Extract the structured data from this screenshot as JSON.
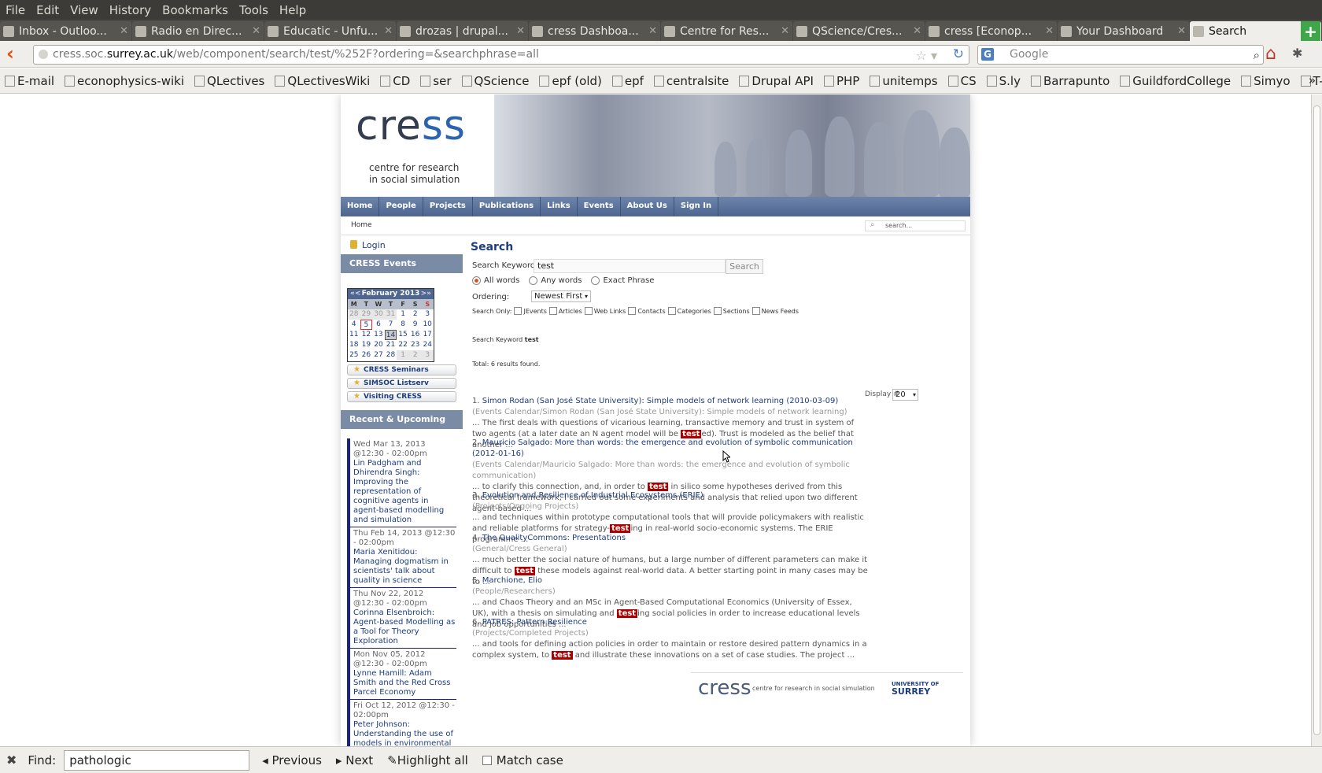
{
  "menubar": [
    "File",
    "Edit",
    "View",
    "History",
    "Bookmarks",
    "Tools",
    "Help"
  ],
  "tabs": [
    {
      "label": "Inbox - Outloo...",
      "icon": "outlook-icon"
    },
    {
      "label": "Radio en Direc...",
      "icon": "radio-icon"
    },
    {
      "label": "Educatic - Unfu...",
      "icon": "unfuddle-icon"
    },
    {
      "label": "drozas | drupal...",
      "icon": "drupal-icon"
    },
    {
      "label": "cress Dashboa...",
      "icon": "page-icon"
    },
    {
      "label": "Centre for Res...",
      "icon": "drupal-icon"
    },
    {
      "label": "QScience/Cres...",
      "icon": "github-icon"
    },
    {
      "label": "cress [Econop...",
      "icon": "epf-icon"
    },
    {
      "label": "Your Dashboard",
      "icon": "page-icon"
    },
    {
      "label": "Search",
      "icon": "page-icon"
    }
  ],
  "url": {
    "pre": "cress.soc.",
    "dom": "surrey.ac.uk",
    "post": "/web/component/search/test/%252F?ordering=&searchphrase=all"
  },
  "search_engine": {
    "placeholder": "Google",
    "icon": "G"
  },
  "bookmarks": [
    {
      "label": "E-mail",
      "icon": "page-icon"
    },
    {
      "label": "econophysics-wiki",
      "icon": "epf-icon"
    },
    {
      "label": "QLectives",
      "icon": "page-icon"
    },
    {
      "label": "QLectivesWiki",
      "icon": "page-icon"
    },
    {
      "label": "CD",
      "icon": "cd-icon"
    },
    {
      "label": "ser",
      "icon": "page-icon"
    },
    {
      "label": "QScience",
      "icon": "github-icon"
    },
    {
      "label": "epf (old)",
      "icon": "epf-icon"
    },
    {
      "label": "epf",
      "icon": "epf-icon"
    },
    {
      "label": "centralsite",
      "icon": "drupal-icon"
    },
    {
      "label": "Drupal API",
      "icon": "drupal-icon"
    },
    {
      "label": "PHP",
      "icon": "php-icon"
    },
    {
      "label": "unitemps",
      "icon": "page-icon"
    },
    {
      "label": "CS",
      "icon": "cs-icon"
    },
    {
      "label": "S.ly",
      "icon": "sly-icon"
    },
    {
      "label": "Barrapunto",
      "icon": "barrapunto-icon"
    },
    {
      "label": "GuildfordCollege",
      "icon": "college-icon"
    },
    {
      "label": "Simyo",
      "icon": "simyo-icon"
    },
    {
      "label": "T-Mob",
      "icon": "tmobile-icon"
    }
  ],
  "site": {
    "logo_a": "cre",
    "logo_b": "ss",
    "tagline1": "centre for research",
    "tagline2": "in social simulation",
    "nav": [
      "Home",
      "People",
      "Projects",
      "Publications",
      "Links",
      "Events",
      "About Us",
      "Sign In"
    ],
    "breadcrumb": "Home",
    "search_placeholder": "search..."
  },
  "sidebar": {
    "login": "Login",
    "calendar_title": "CRESS Events Calendar",
    "calendar": {
      "prev": "«<",
      "month": "February 2013",
      "next": ">»",
      "dow": [
        "M",
        "T",
        "W",
        "T",
        "F",
        "S",
        "S"
      ],
      "weeks": [
        [
          "28",
          "29",
          "30",
          "31",
          "1",
          "2",
          "3"
        ],
        [
          "4",
          "5",
          "6",
          "7",
          "8",
          "9",
          "10"
        ],
        [
          "11",
          "12",
          "13",
          "14",
          "15",
          "16",
          "17"
        ],
        [
          "18",
          "19",
          "20",
          "21",
          "22",
          "23",
          "24"
        ],
        [
          "25",
          "26",
          "27",
          "28",
          "1",
          "2",
          "3"
        ]
      ]
    },
    "links": [
      "CRESS Seminars",
      "SIMSOC Listserv",
      "Visiting CRESS"
    ],
    "events_title": "Recent & Upcoming Events",
    "events": [
      {
        "date": "Wed Mar 13, 2013 @12:30 - 02:00pm",
        "title": "Lin Padgham and Dhirendra Singh: Improving the representation of cognitive agents in agent-based modelling and simulation"
      },
      {
        "date": "Thu Feb 14, 2013 @12:30 - 02:00pm",
        "title": "Maria Xenitidou: Managing dogmatism in scientists' talk about quality in science"
      },
      {
        "date": "Thu Nov 22, 2012 @12:30 - 02:00pm",
        "title": "Corinna Elsenbroich: Agent-based Modelling as a Tool for Theory Exploration"
      },
      {
        "date": "Mon Nov 05, 2012 @12:30 - 02:00pm",
        "title": "Lynne Hamill: Adam Smith and the Red Cross Parcel Economy"
      },
      {
        "date": "Fri Oct 12, 2012 @12:30 - 02:00pm",
        "title": "Peter Johnson: Understanding the use of models in environmental"
      }
    ]
  },
  "search": {
    "heading": "Search",
    "keyword_label": "Search Keyword:",
    "keyword": "test",
    "button": "Search",
    "radios": [
      "All words",
      "Any words",
      "Exact Phrase"
    ],
    "ordering_label": "Ordering:",
    "ordering": "Newest First",
    "only_label": "Search Only:",
    "only": [
      "JEvents",
      "Articles",
      "Web Links",
      "Contacts",
      "Categories",
      "Sections",
      "News Feeds"
    ],
    "summary_label": "Search Keyword",
    "summary_keyword": "test",
    "total": "Total: 6 results found.",
    "display_label": "Display #",
    "display": "20"
  },
  "results": [
    {
      "n": "1.",
      "title": "Simon Rodan (San José State University): Simple models of network learning (2010-03-09)",
      "cat": "(Events Calendar/Simon Rodan (San José State University): Simple models of network learning)",
      "pre": "... The first deals with questions of vicarious learning, transactive memory and trust in system of two agents (at a later date an N agent model will be ",
      "hl": "test",
      "post": "ed). Trust is modeled as the belief that another ..."
    },
    {
      "n": "2.",
      "title": "Mauricio Salgado: More than words: the emergence and evolution of symbolic communication (2012-01-16)",
      "cat": "(Events Calendar/Mauricio Salgado: More than words: the emergence and evolution of symbolic communication)",
      "pre": "... to clarify this connection, and, in order to ",
      "hl": "test",
      "post": " in silico some hypotheses derived from this theoretical framework, I carried out some experiments and analysis that relied upon two different agent-based ..."
    },
    {
      "n": "3.",
      "title": "Evolution and Resilience of Industrial Ecosystems (ERIE)",
      "cat": "(Projects/Ongoing Projects)",
      "pre": "... and techniques within prototype computational tools that will provide policymakers with realistic and reliable platforms for strategy-",
      "hl": "test",
      "post": "ing in real-world socio-economic systems.   The ERIE programme ..."
    },
    {
      "n": "4.",
      "title": "The QualityCommons: Presentations",
      "cat": "(General/Cress General)",
      "pre": "... much better the social nature of humans, but a large number of different parameters can make it difficult to ",
      "hl": "test",
      "post": " these models against real-world data. A better starting point in many cases may be to ..."
    },
    {
      "n": "5.",
      "title": "Marchione, Elio",
      "cat": "(People/Researchers)",
      "pre": "... and Chaos Theory and an MSc in Agent-Based Computational Economics (University of Essex, UK), with a thesis on simulating and ",
      "hl": "test",
      "post": "ing social policies in order to increase educational levels and job opportunities ..."
    },
    {
      "n": "6.",
      "title": "PATRES: Pattern Resilience",
      "cat": "(Projects/Completed Projects)",
      "pre": "... and tools for defining action policies in order to maintain or restore desired pattern dynamics in a complex system, to ",
      "hl": "test",
      "post": " and illustrate these innovations on a set of case studies. The project ..."
    }
  ],
  "footer": {
    "logo": "cress",
    "tagline": "centre for research in social simulation",
    "univ_small": "UNIVERSITY OF",
    "univ": "SURREY"
  },
  "findbar": {
    "label": "Find:",
    "value": "pathologic",
    "prev": "Previous",
    "next": "Next",
    "highlight": "Highlight all",
    "match": "Match case"
  }
}
